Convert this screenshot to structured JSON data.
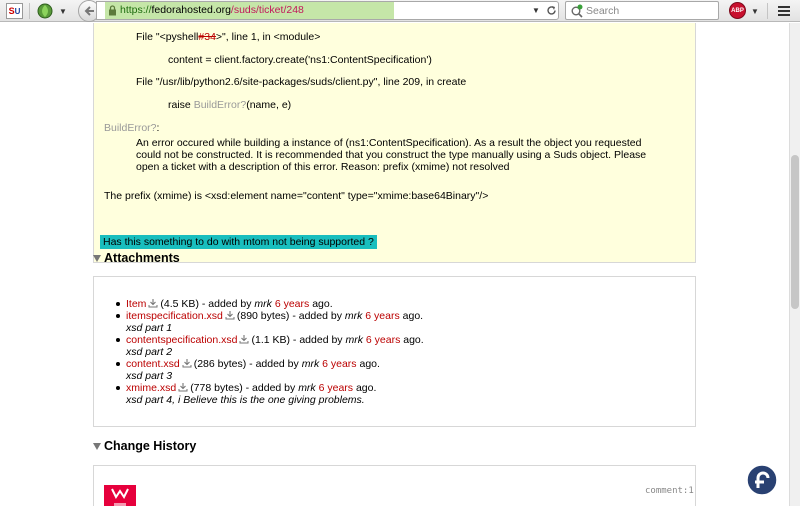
{
  "toolbar": {
    "url_scheme": "https://",
    "url_host": "fedorahosted.org",
    "url_path": "/suds/ticket/248",
    "search_placeholder": "Search",
    "abp_label": "ABP",
    "su_label": "S",
    "su_sup": "U"
  },
  "description": {
    "file_line_1": "File \"<pyshell",
    "file_line_1_link": "#34",
    "file_line_1_end": ">\", line 1, in <module>",
    "code_line_1": "content = client.factory.create('ns1:ContentSpecification')",
    "file_line_2": "File \"/usr/lib/python2.6/site-packages/suds/client.py\", line 209, in create",
    "raise_prefix": "raise",
    "raise_link": "BuildError?",
    "raise_suffix": "(name, e)",
    "error_label": "BuildError?",
    "error_colon": ":",
    "error_paragraph": "An error occured while building a instance of (ns1:ContentSpecification). As a result the object you requested could not be constructed. It is recommended that you construct the type manually using a Suds object. Please open a ticket with a description of this error. Reason: prefix (xmime) not resolved",
    "prefix_line": "The prefix (xmime) is <xsd:element name=\"content\" type=\"xmime:base64Binary\"/>",
    "highlight_text": "Has this something to do with mtom not being supported ?"
  },
  "attachments": {
    "heading": "Attachments",
    "items": [
      {
        "name": "Item",
        "size": "(4.5 KB)",
        "added_by": "- added by",
        "author": "mrk",
        "age": "6 years",
        "ago": "ago.",
        "description": ""
      },
      {
        "name": "itemspecification.xsd",
        "size": "(890 bytes)",
        "added_by": "- added by",
        "author": "mrk",
        "age": "6 years",
        "ago": "ago.",
        "description": "xsd part 1"
      },
      {
        "name": "contentspecification.xsd",
        "size": "(1.1 KB)",
        "added_by": "- added by",
        "author": "mrk",
        "age": "6 years",
        "ago": "ago.",
        "description": "xsd part 2"
      },
      {
        "name": "content.xsd",
        "size": "(286 bytes)",
        "added_by": "- added by",
        "author": "mrk",
        "age": "6 years",
        "ago": "ago.",
        "description": "xsd part 3"
      },
      {
        "name": "xmime.xsd",
        "size": "(778 bytes)",
        "added_by": "- added by",
        "author": "mrk",
        "age": "6 years",
        "ago": "ago.",
        "description": "xsd part 4, i Believe this is the one giving problems."
      }
    ]
  },
  "history": {
    "heading": "Change History",
    "comment_label": "comment:1"
  },
  "colors": {
    "description_bg": "#ffffdd",
    "link_red": "#bb0000",
    "highlight": "#19bebe",
    "url_green": "#c5e6a8"
  }
}
